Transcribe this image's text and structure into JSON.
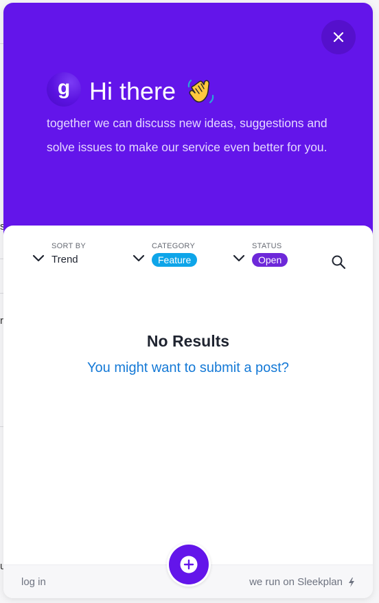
{
  "header": {
    "greeting": "Hi there",
    "subtitle": "together we can discuss new ideas, suggestions and solve issues to make our service even better for you.",
    "logo_letter": "g",
    "wave_icon": "waving-hand-emoji"
  },
  "filters": {
    "sort": {
      "label": "SORT BY",
      "value": "Trend"
    },
    "category": {
      "label": "CATEGORY",
      "value": "Feature",
      "color": "#0ea5e9"
    },
    "status": {
      "label": "STATUS",
      "value": "Open",
      "color": "#6d28d9"
    }
  },
  "empty_state": {
    "title": "No Results",
    "link": "You might want to submit a post?"
  },
  "footer": {
    "login": "log in",
    "powered_by": "we run on Sleekplan"
  },
  "colors": {
    "brand": "#6315ea",
    "link": "#1479d6"
  }
}
